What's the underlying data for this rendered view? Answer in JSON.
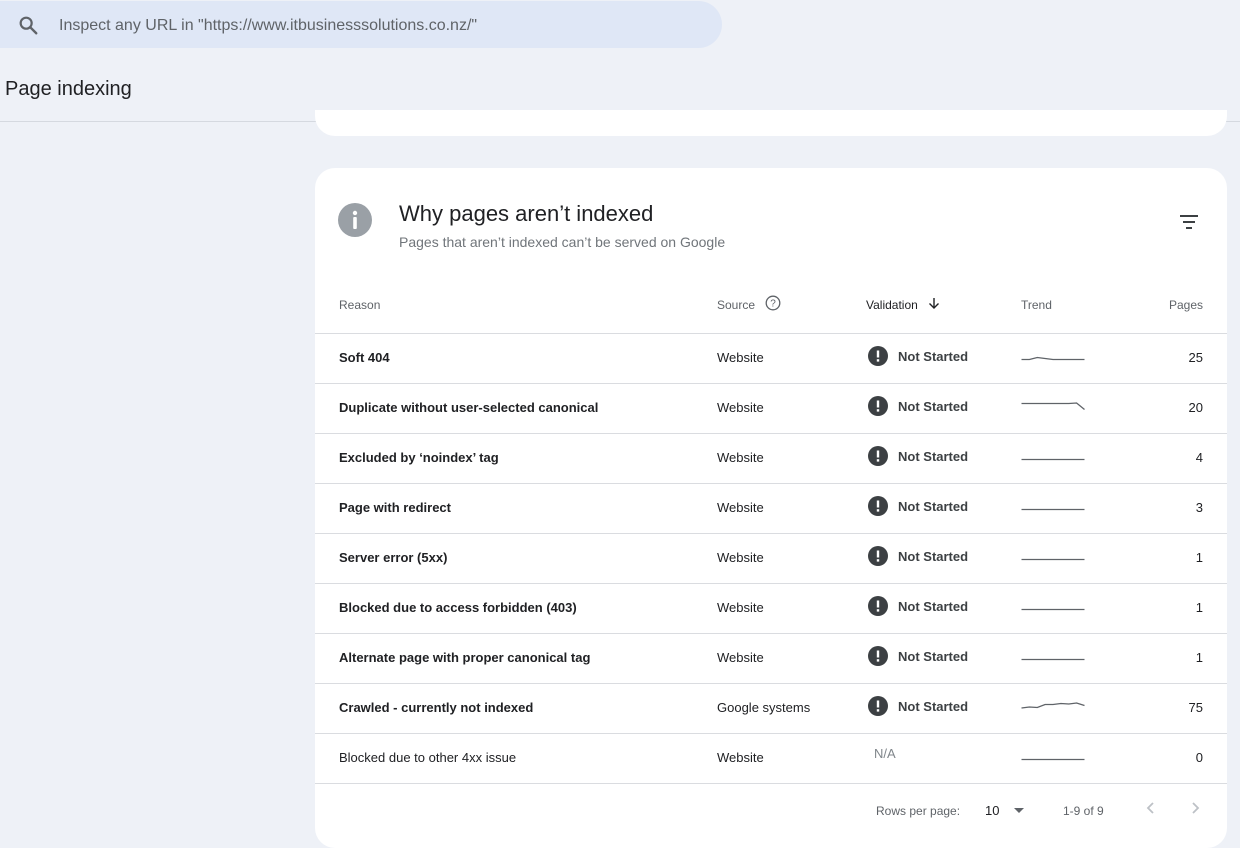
{
  "search": {
    "placeholder": "Inspect any URL in \"https://www.itbusinesssolutions.co.nz/\""
  },
  "page_title": "Page indexing",
  "card": {
    "title": "Why pages aren’t indexed",
    "subtitle": "Pages that aren’t indexed can’t be served on Google"
  },
  "table": {
    "headers": {
      "reason": "Reason",
      "source": "Source",
      "validation": "Validation",
      "trend": "Trend",
      "pages": "Pages"
    },
    "rows": [
      {
        "reason": "Soft 404",
        "source": "Website",
        "validation": "Not Started",
        "pages": "25",
        "trend": [
          0,
          0,
          0.2,
          0.1,
          0,
          0,
          0,
          0,
          0
        ]
      },
      {
        "reason": "Duplicate without user-selected canonical",
        "source": "Website",
        "validation": "Not Started",
        "pages": "20",
        "trend": [
          0.6,
          0.6,
          0.6,
          0.6,
          0.6,
          0.6,
          0.6,
          0.65,
          0
        ]
      },
      {
        "reason": "Excluded by ‘noindex’ tag",
        "source": "Website",
        "validation": "Not Started",
        "pages": "4",
        "trend": [
          0,
          0,
          0,
          0,
          0,
          0,
          0,
          0,
          0
        ]
      },
      {
        "reason": "Page with redirect",
        "source": "Website",
        "validation": "Not Started",
        "pages": "3",
        "trend": [
          0,
          0,
          0,
          0,
          0,
          0,
          0,
          0,
          0
        ]
      },
      {
        "reason": "Server error (5xx)",
        "source": "Website",
        "validation": "Not Started",
        "pages": "1",
        "trend": [
          0,
          0,
          0,
          0,
          0,
          0,
          0,
          0,
          0
        ]
      },
      {
        "reason": "Blocked due to access forbidden (403)",
        "source": "Website",
        "validation": "Not Started",
        "pages": "1",
        "trend": [
          0,
          0,
          0,
          0,
          0,
          0,
          0,
          0,
          0
        ]
      },
      {
        "reason": "Alternate page with proper canonical tag",
        "source": "Website",
        "validation": "Not Started",
        "pages": "1",
        "trend": [
          0,
          0,
          0,
          0,
          0,
          0,
          0,
          0,
          0
        ]
      },
      {
        "reason": "Crawled - currently not indexed",
        "source": "Google systems",
        "validation": "Not Started",
        "pages": "75",
        "trend": [
          0.15,
          0.25,
          0.2,
          0.5,
          0.5,
          0.6,
          0.55,
          0.65,
          0.4
        ]
      },
      {
        "reason": "Blocked due to other 4xx issue",
        "source": "Website",
        "validation": "N/A",
        "pages": "0",
        "trend": [
          0,
          0,
          0,
          0,
          0,
          0,
          0,
          0,
          0
        ]
      }
    ]
  },
  "footer": {
    "rows_label": "Rows per page:",
    "rows_value": "10",
    "range": "1-9 of 9"
  },
  "colors": {
    "trend_line": "#5f6368",
    "alert_icon": "#3c4043",
    "info_icon": "#9aa0a6",
    "search_bg": "#dfe7f6"
  }
}
